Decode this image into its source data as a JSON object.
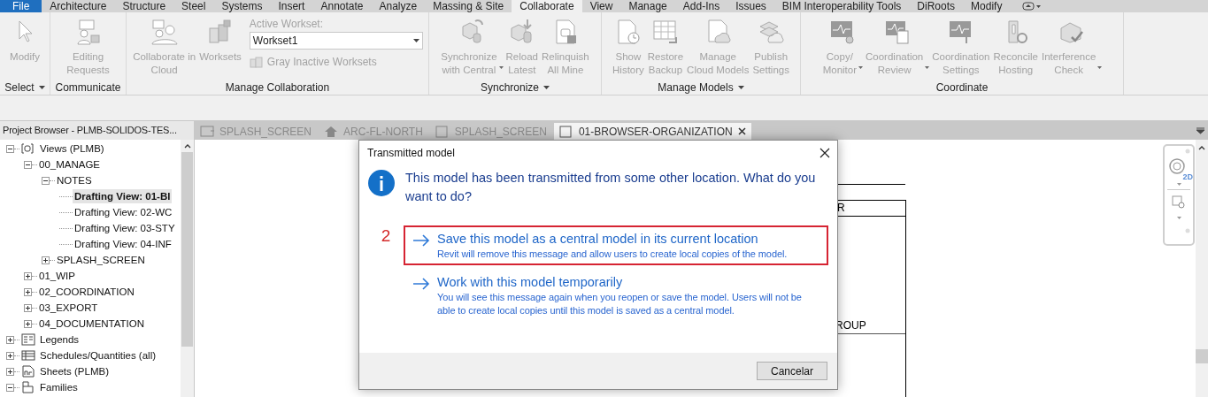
{
  "menu_tabs": [
    {
      "label": "File",
      "kind": "file"
    },
    {
      "label": "Architecture",
      "kind": "tab",
      "selected": false
    },
    {
      "label": "Structure",
      "kind": "tab",
      "selected": false
    },
    {
      "label": "Steel",
      "kind": "tab",
      "selected": false
    },
    {
      "label": "Systems",
      "kind": "tab",
      "selected": false
    },
    {
      "label": "Insert",
      "kind": "tab",
      "selected": false
    },
    {
      "label": "Annotate",
      "kind": "tab",
      "selected": false
    },
    {
      "label": "Analyze",
      "kind": "tab",
      "selected": false
    },
    {
      "label": "Massing & Site",
      "kind": "tab",
      "selected": false
    },
    {
      "label": "Collaborate",
      "kind": "tab",
      "selected": true
    },
    {
      "label": "View",
      "kind": "tab",
      "selected": false
    },
    {
      "label": "Manage",
      "kind": "tab",
      "selected": false
    },
    {
      "label": "Add-Ins",
      "kind": "tab",
      "selected": false
    },
    {
      "label": "Issues",
      "kind": "tab",
      "selected": false
    },
    {
      "label": "BIM Interoperability Tools",
      "kind": "tab",
      "selected": false
    },
    {
      "label": "DiRoots",
      "kind": "tab",
      "selected": false
    },
    {
      "label": "Modify",
      "kind": "tab",
      "selected": false
    }
  ],
  "ribbon": {
    "panels": [
      {
        "title": "Select",
        "has_menu": true,
        "tools": [
          {
            "kind": "large",
            "label": "Modify",
            "disabled": true,
            "has_menu": false
          }
        ]
      },
      {
        "title": "Communicate",
        "has_menu": false,
        "tools": [
          {
            "kind": "large",
            "label": "Editing\nRequests",
            "disabled": true,
            "has_menu": false
          }
        ]
      },
      {
        "title": "Manage Collaboration",
        "has_menu": false,
        "tools": [
          {
            "kind": "large",
            "label": "Collaborate in\nCloud",
            "disabled": true,
            "has_menu": false
          },
          {
            "kind": "large",
            "label": "Worksets",
            "disabled": true,
            "has_menu": false
          },
          {
            "kind": "workset",
            "label": "Active Workset:",
            "value": "Workset1",
            "button": "Gray Inactive Worksets",
            "disabled": true
          }
        ]
      },
      {
        "title": "Synchronize",
        "has_menu": true,
        "tools": [
          {
            "kind": "large",
            "label": "Synchronize\nwith Central",
            "disabled": true,
            "has_menu": true
          },
          {
            "kind": "large",
            "label": "Reload\nLatest",
            "disabled": true,
            "has_menu": false
          },
          {
            "kind": "large",
            "label": "Relinquish\nAll Mine",
            "disabled": true,
            "has_menu": false
          }
        ]
      },
      {
        "title": "Manage Models",
        "has_menu": true,
        "tools": [
          {
            "kind": "large",
            "label": "Show\nHistory",
            "disabled": true,
            "has_menu": false
          },
          {
            "kind": "large",
            "label": "Restore\nBackup",
            "disabled": true,
            "has_menu": false
          },
          {
            "kind": "large",
            "label": "Manage\nCloud Models",
            "disabled": true,
            "has_menu": false
          },
          {
            "kind": "large",
            "label": "Publish\nSettings",
            "disabled": true,
            "has_menu": false
          }
        ]
      },
      {
        "title": "Coordinate",
        "has_menu": false,
        "tools": [
          {
            "kind": "large",
            "label": "Copy/\nMonitor",
            "disabled": true,
            "has_menu": true
          },
          {
            "kind": "large",
            "label": "Coordination\nReview",
            "disabled": true,
            "has_menu": true
          },
          {
            "kind": "large",
            "label": "Coordination\nSettings",
            "disabled": true,
            "has_menu": false
          },
          {
            "kind": "large",
            "label": "Reconcile\nHosting",
            "disabled": true,
            "has_menu": false
          },
          {
            "kind": "large",
            "label": "Interference\nCheck",
            "disabled": true,
            "has_menu": true
          }
        ]
      }
    ]
  },
  "project_browser": {
    "title": "Project Browser - PLMB-SOLIDOS-TES...",
    "tree": [
      {
        "label": "Views (PLMB)",
        "expanded": true,
        "children": [
          {
            "label": "00_MANAGE",
            "expanded": true,
            "children": [
              {
                "label": "NOTES",
                "expanded": true,
                "children": [
                  {
                    "label": "Drafting View: 01-BI",
                    "selected": true
                  },
                  {
                    "label": "Drafting View: 02-WC",
                    "selected": false
                  },
                  {
                    "label": "Drafting View: 03-STY",
                    "selected": false
                  },
                  {
                    "label": "Drafting View: 04-INF",
                    "selected": false
                  }
                ]
              },
              {
                "label": "SPLASH_SCREEN",
                "expanded": false
              }
            ]
          },
          {
            "label": "01_WIP",
            "expanded": false
          },
          {
            "label": "02_COORDINATION",
            "expanded": false
          },
          {
            "label": "03_EXPORT",
            "expanded": false
          },
          {
            "label": "04_DOCUMENTATION",
            "expanded": false
          }
        ]
      },
      {
        "label": "Legends",
        "expanded": false
      },
      {
        "label": "Schedules/Quantities (all)",
        "expanded": false
      },
      {
        "label": "Sheets (PLMB)",
        "expanded": false
      },
      {
        "label": "Families",
        "expanded": true
      }
    ]
  },
  "view_tabs": [
    {
      "label": "SPLASH_SCREEN",
      "selected": false
    },
    {
      "label": "ARC-FL-NORTH",
      "selected": false
    },
    {
      "label": "SPLASH_SCREEN",
      "selected": false
    },
    {
      "label": "01-BROWSER-ORGANIZATION",
      "selected": true
    }
  ],
  "drawing_texts": [
    "R",
    "ROUP"
  ],
  "nav_bar": {
    "label": "2D"
  },
  "dialog": {
    "title": "Transmitted model",
    "message": "This model has been transmitted from some other location. What do you want to do?",
    "options": [
      {
        "title": "Save this model as a central model in its current location",
        "description": "Revit will remove this message and allow users to create local copies of the model.",
        "highlighted": true,
        "marker": "2"
      },
      {
        "title": "Work with this model temporarily",
        "description": "You will see this message again when you reopen or save the model. Users will not be able to create local copies until this model is saved as a central model.",
        "highlighted": false
      }
    ],
    "buttons": [
      "Cancelar"
    ]
  }
}
